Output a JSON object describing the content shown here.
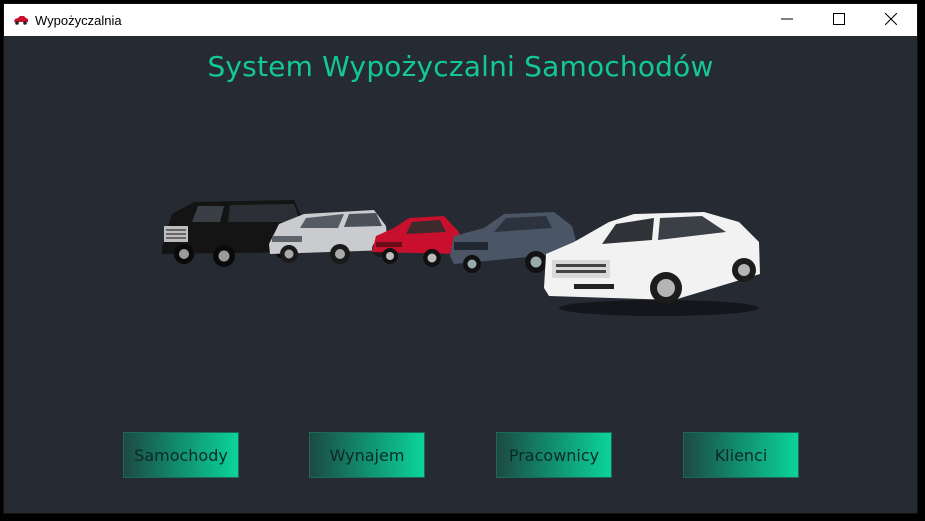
{
  "window": {
    "title": "Wypożyczalnia",
    "icon": "red-car-icon",
    "controls": {
      "minimize": "—",
      "maximize": "☐",
      "close": "✕"
    }
  },
  "main": {
    "title": "System Wypożyczalni Samochodów",
    "image": "car-lineup-image"
  },
  "nav": {
    "samochody": "Samochody",
    "wynajem": "Wynajem",
    "pracownicy": "Pracownicy",
    "klienci": "Klienci"
  },
  "colors": {
    "background": "#262a33",
    "accent": "#12c896",
    "button_gradient_start": "#1c4a43",
    "button_gradient_end": "#0bd39c"
  }
}
